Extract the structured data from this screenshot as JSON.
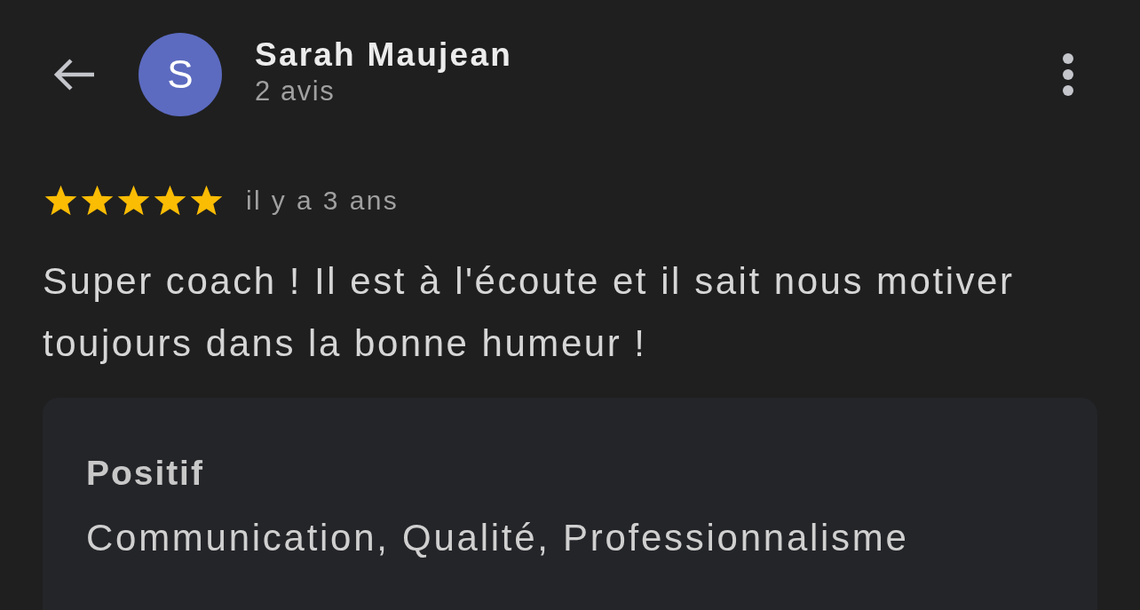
{
  "reviewer": {
    "initial": "S",
    "name": "Sarah Maujean",
    "review_count": "2 avis"
  },
  "review": {
    "stars": 5,
    "time": "il y a 3 ans",
    "text": "Super coach ! Il est à l'écoute et il sait nous motiver toujours dans la bonne humeur !"
  },
  "attributes": [
    {
      "title": "Positif",
      "value": "Communication, Qualité, Professionnalisme"
    }
  ]
}
